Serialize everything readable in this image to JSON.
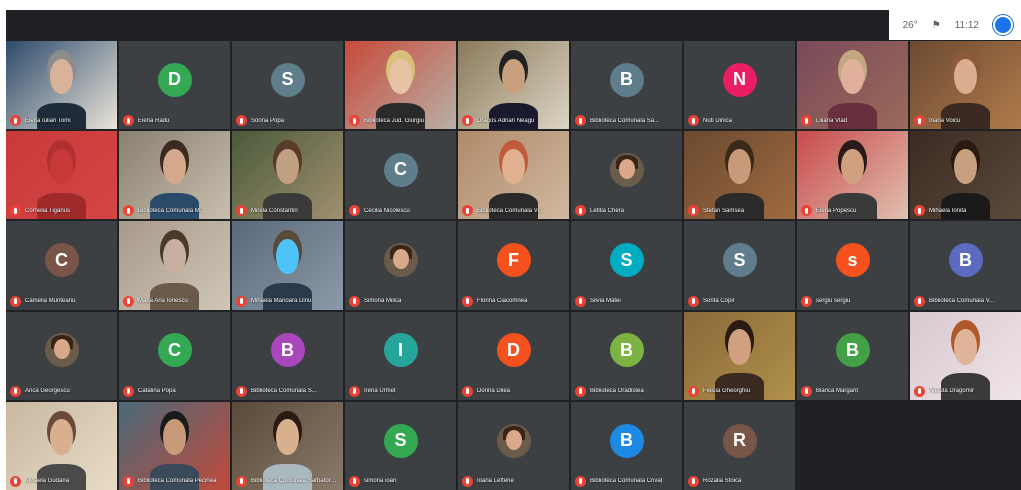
{
  "topbar": {
    "people_count": "26°",
    "chat_label": "⚑",
    "clock": "11:12"
  },
  "colors": {
    "background": "#202124",
    "tile": "#3c4043",
    "muted_badge": "#ea4335",
    "accent": "#1a73e8"
  },
  "tiles": [
    {
      "name": "Elena Iulian Tomi",
      "kind": "video",
      "bg": "#2d4a6b",
      "face": "#d8b39a",
      "hair": "#8c8c8c",
      "body": "#1d2b3a",
      "extra": "#e9e3d8"
    },
    {
      "name": "Elena Radu",
      "kind": "avatar",
      "letter": "D",
      "color": "#34a853"
    },
    {
      "name": "Sorina Popa",
      "kind": "avatar",
      "letter": "S",
      "color": "#5f7d8b"
    },
    {
      "name": "Biblioteca Jud. Giurgiu",
      "kind": "video",
      "bg": "#c74a3a",
      "face": "#e7c3a6",
      "hair": "#d8c07a",
      "body": "#2a2a2a",
      "extra": "#b8b0a6"
    },
    {
      "name": "Dragos Adrian Neagu",
      "kind": "video",
      "bg": "#8a7a5a",
      "face": "#c9a07e",
      "hair": "#222222",
      "body": "#1a1a2e",
      "extra": "#dcd4c4"
    },
    {
      "name": "Biblioteca Comunala Sa...",
      "kind": "avatar",
      "letter": "B",
      "color": "#5f7d8b"
    },
    {
      "name": "Nuti Dinica",
      "kind": "avatar",
      "letter": "N",
      "color": "#e91e63"
    },
    {
      "name": "Liliana Vlad",
      "kind": "video",
      "bg": "#7a4a5a",
      "face": "#e0b09a",
      "hair": "#c2a882",
      "body": "#6a2f3f",
      "extra": "#9a6a5a"
    },
    {
      "name": "Ioana Voicu",
      "kind": "video",
      "bg": "#6b4a32",
      "face": "#d9ad8e",
      "hair": "#8a5a3a",
      "body": "#3a2a22",
      "extra": "#b07a4a"
    },
    {
      "name": "Cornelia Tiganus",
      "kind": "video",
      "bg": "#c83a3a",
      "face": "#c83a3a",
      "hair": "#b03030",
      "body": "#a02a2a",
      "extra": "#d64545"
    },
    {
      "name": "Biblioteca Comunala M...",
      "kind": "video",
      "bg": "#8a8070",
      "face": "#d4a88a",
      "hair": "#3a2a22",
      "body": "#2a4a6a",
      "extra": "#c9bfae"
    },
    {
      "name": "Mirela Constantin",
      "kind": "video",
      "bg": "#4a5a3a",
      "face": "#c0a080",
      "hair": "#5a3a2a",
      "body": "#3a3a3a",
      "extra": "#a09070"
    },
    {
      "name": "Cecilia Nicolescu",
      "kind": "avatar",
      "letter": "C",
      "color": "#5f7d8b"
    },
    {
      "name": "Biblioteca Comunala Vi...",
      "kind": "video",
      "bg": "#b08a6a",
      "face": "#e0b090",
      "hair": "#c05a3a",
      "body": "#2a2a2a",
      "extra": "#d0b8a0"
    },
    {
      "name": "Letitia Chera",
      "kind": "photo"
    },
    {
      "name": "Stefan Samsea",
      "kind": "video",
      "bg": "#6a4a30",
      "face": "#c89a7a",
      "hair": "#3a2a1a",
      "body": "#2a2a2a",
      "extra": "#a06a40"
    },
    {
      "name": "Elena Popescu",
      "kind": "video",
      "bg": "#c84a4a",
      "face": "#d0a080",
      "hair": "#2a1a1a",
      "body": "#3a3a3a",
      "extra": "#e0c0b0"
    },
    {
      "name": "Mihaela Ionita",
      "kind": "video",
      "bg": "#3a2a22",
      "face": "#c8a080",
      "hair": "#2a1a12",
      "body": "#1a1a1a",
      "extra": "#5a4a3a"
    },
    {
      "name": "Camelia Munteanu",
      "kind": "avatar",
      "letter": "C",
      "color": "#795548"
    },
    {
      "name": "Maria Ana Ionescu",
      "kind": "video",
      "bg": "#a89a8a",
      "face": "#c8b0a0",
      "hair": "#4a3a2a",
      "body": "#6a5a4a",
      "extra": "#cfc6b8"
    },
    {
      "name": "Mihaela Marioara Dinu",
      "kind": "video",
      "bg": "#5a6a7a",
      "face": "#4fc3f7",
      "hair": "#5a4a3a",
      "body": "#2a3a4a",
      "extra": "#8a9aa8"
    },
    {
      "name": "Simona Milica",
      "kind": "photo"
    },
    {
      "name": "Florina Ciacomnea",
      "kind": "avatar",
      "letter": "F",
      "color": "#f4511e"
    },
    {
      "name": "Silvia Matei",
      "kind": "avatar",
      "letter": "S",
      "color": "#00acc1"
    },
    {
      "name": "Sorita Copil",
      "kind": "avatar",
      "letter": "S",
      "color": "#5f7d8b"
    },
    {
      "name": "sergiu sergiu",
      "kind": "avatar",
      "letter": "s",
      "color": "#f4511e"
    },
    {
      "name": "Biblioteca Comunala V...",
      "kind": "avatar",
      "letter": "B",
      "color": "#5c6bc0"
    },
    {
      "name": "Anca Georgescu",
      "kind": "photo"
    },
    {
      "name": "Cătălina Popa",
      "kind": "avatar",
      "letter": "C",
      "color": "#34a853"
    },
    {
      "name": "Biblioteca Comunala S...",
      "kind": "avatar",
      "letter": "B",
      "color": "#ab47bc"
    },
    {
      "name": "Irena Urmet",
      "kind": "avatar",
      "letter": "I",
      "color": "#26a69a"
    },
    {
      "name": "Dorina Dilea",
      "kind": "avatar",
      "letter": "D",
      "color": "#f4511e"
    },
    {
      "name": "Biblioteca Oradistea",
      "kind": "avatar",
      "letter": "B",
      "color": "#7cb342"
    },
    {
      "name": "Felicia Gheorghiu",
      "kind": "video",
      "bg": "#8a6a3a",
      "face": "#d0a080",
      "hair": "#2a1a12",
      "body": "#3a2a22",
      "extra": "#b0904a"
    },
    {
      "name": "Bianca Margarit",
      "kind": "avatar",
      "letter": "B",
      "color": "#43a047"
    },
    {
      "name": "Ancuta Dragomir",
      "kind": "video",
      "bg": "#d8c8d0",
      "face": "#e0b49a",
      "hair": "#b05a2a",
      "body": "#3a3a3a",
      "extra": "#efe4e8"
    },
    {
      "name": "Mihaela Gudana",
      "kind": "video",
      "bg": "#c8b8a0",
      "face": "#d8b090",
      "hair": "#6a4a3a",
      "body": "#4a4a4a",
      "extra": "#e8dcc8"
    },
    {
      "name": "Biblioteca Comunala Pecinea",
      "kind": "video",
      "bg": "#4a6a7a",
      "face": "#c89a7a",
      "hair": "#1a1a1a",
      "body": "#3a4a5a",
      "extra": "#c04a3a"
    },
    {
      "name": "Biblioteca Comunala Sarbatoresti",
      "kind": "video",
      "bg": "#5a4a3a",
      "face": "#d8b090",
      "hair": "#2a1a12",
      "body": "#aab8c0",
      "extra": "#8a7a6a"
    },
    {
      "name": "simona ioan",
      "kind": "avatar",
      "letter": "S",
      "color": "#34a853"
    },
    {
      "name": "Ioana Lefterie",
      "kind": "photo"
    },
    {
      "name": "Biblioteca Comunala Crivăț",
      "kind": "avatar",
      "letter": "B",
      "color": "#1e88e5"
    },
    {
      "name": "Rozalia Stoica",
      "kind": "avatar",
      "letter": "R",
      "color": "#795548"
    }
  ]
}
